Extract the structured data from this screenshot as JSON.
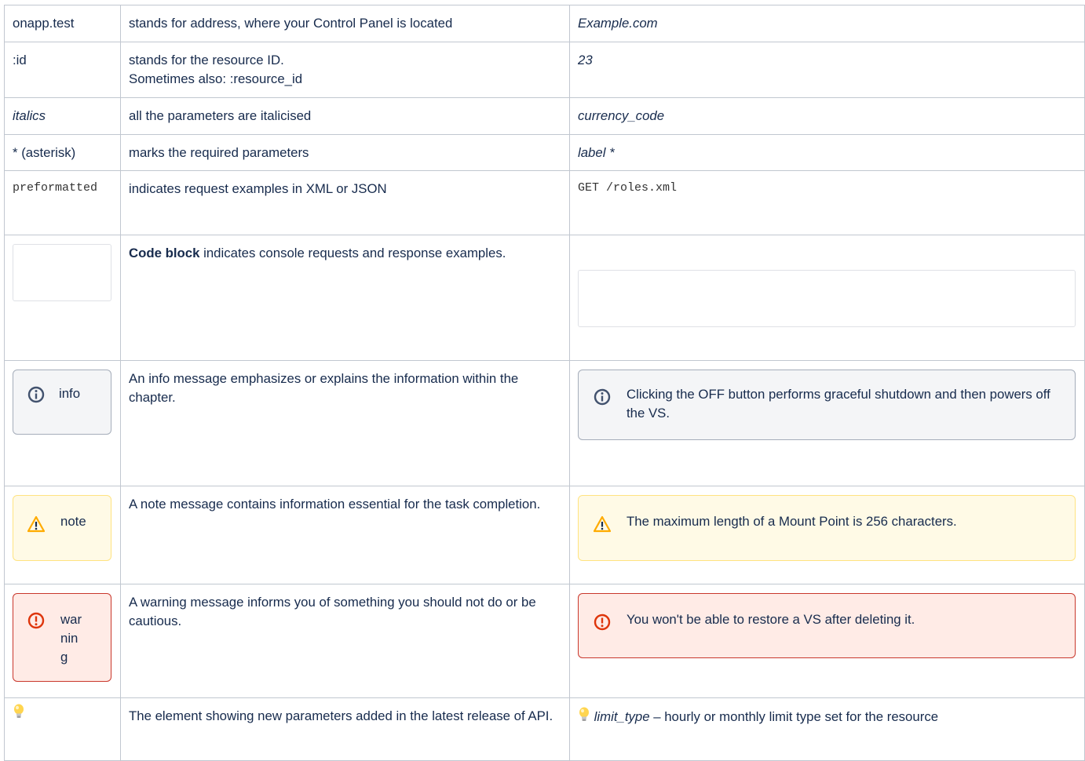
{
  "rows": [
    {
      "key": "onapp.test",
      "desc": "stands for address, where your Control Panel is located",
      "example": "Example.com"
    },
    {
      "key": ":id",
      "desc_line1": "stands for the resource ID.",
      "desc_line2": "Sometimes also: :resource_id",
      "example": "23"
    },
    {
      "key": "italics",
      "desc": "all the parameters are italicised",
      "example": "currency_code"
    },
    {
      "key": "* (asterisk)",
      "desc": "marks the required parameters",
      "example": "label *"
    },
    {
      "key": "preformatted",
      "desc": "indicates request examples in XML or JSON",
      "example": "GET /roles.xml"
    },
    {
      "desc_bold": "Code block",
      "desc_rest": " indicates console requests and response examples."
    },
    {
      "label": "info",
      "desc": "An info message emphasizes or explains the information within the chapter.",
      "example": "Clicking the OFF button performs graceful shutdown and then powers off the VS."
    },
    {
      "label": "note",
      "desc": "A note message contains information essential for the task completion.",
      "example": "The maximum length of a Mount Point is 256 characters."
    },
    {
      "label": "warning",
      "desc": "A warning message informs you of something you should not do or be cautious.",
      "example": "You won't be able to restore a VS after deleting it."
    },
    {
      "desc": "The element showing new parameters added in the latest release of API.",
      "example_param": "limit_type",
      "example_rest": " – hourly or monthly limit type set for the resource"
    }
  ],
  "icons": {
    "info": "info-circle-icon",
    "note": "warning-triangle-icon",
    "warning": "error-circle-icon",
    "new": "lightbulb-icon"
  },
  "colors": {
    "info_bg": "#f4f5f7",
    "note_bg": "#fffae6",
    "warning_bg": "#ffebe6",
    "warning_border": "#c9372c",
    "note_icon": "#ffab00",
    "info_icon": "#42526e"
  }
}
